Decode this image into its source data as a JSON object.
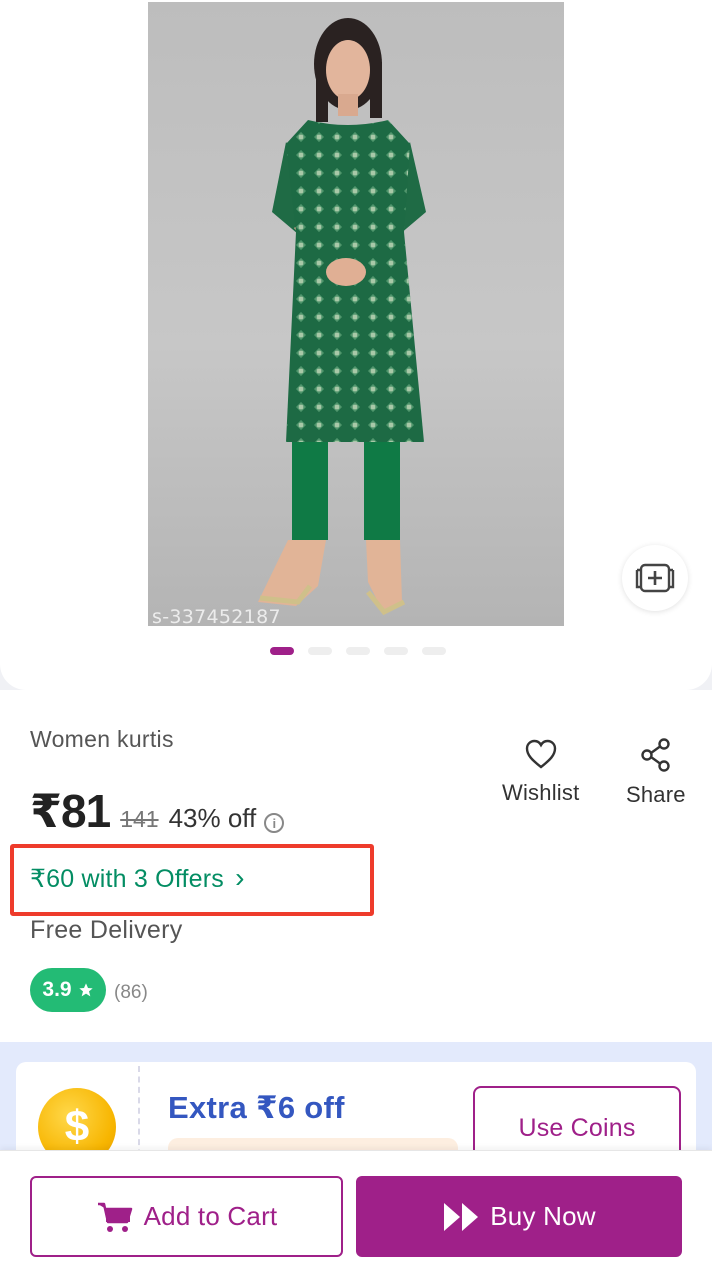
{
  "product": {
    "sku_watermark": "s-337452187",
    "title": "Women kurtis",
    "price": "₹81",
    "mrp": "141",
    "discount": "43% off",
    "offers_link": "₹60 with 3 Offers",
    "offers_chevron": "›",
    "delivery": "Free Delivery",
    "rating": "3.9",
    "rating_count": "(86)",
    "image_pages": 5,
    "active_image": 1
  },
  "actions": {
    "wishlist_label": "Wishlist",
    "share_label": "Share"
  },
  "coins": {
    "offer_text": "Extra ₹6 off",
    "button_label": "Use Coins"
  },
  "bottom_bar": {
    "add_to_cart_label": "Add to Cart",
    "buy_now_label": "Buy Now"
  },
  "colors": {
    "brand": "#9f2089",
    "offer_green": "#038d63",
    "rating_green": "#23bb75",
    "highlight_red": "#ee3b2b",
    "coins_blue": "#3457c0"
  },
  "icons": [
    "similar-products-icon",
    "info-icon",
    "star-icon",
    "heart-icon",
    "share-icon",
    "coin-icon",
    "cart-icon",
    "fast-forward-icon"
  ]
}
